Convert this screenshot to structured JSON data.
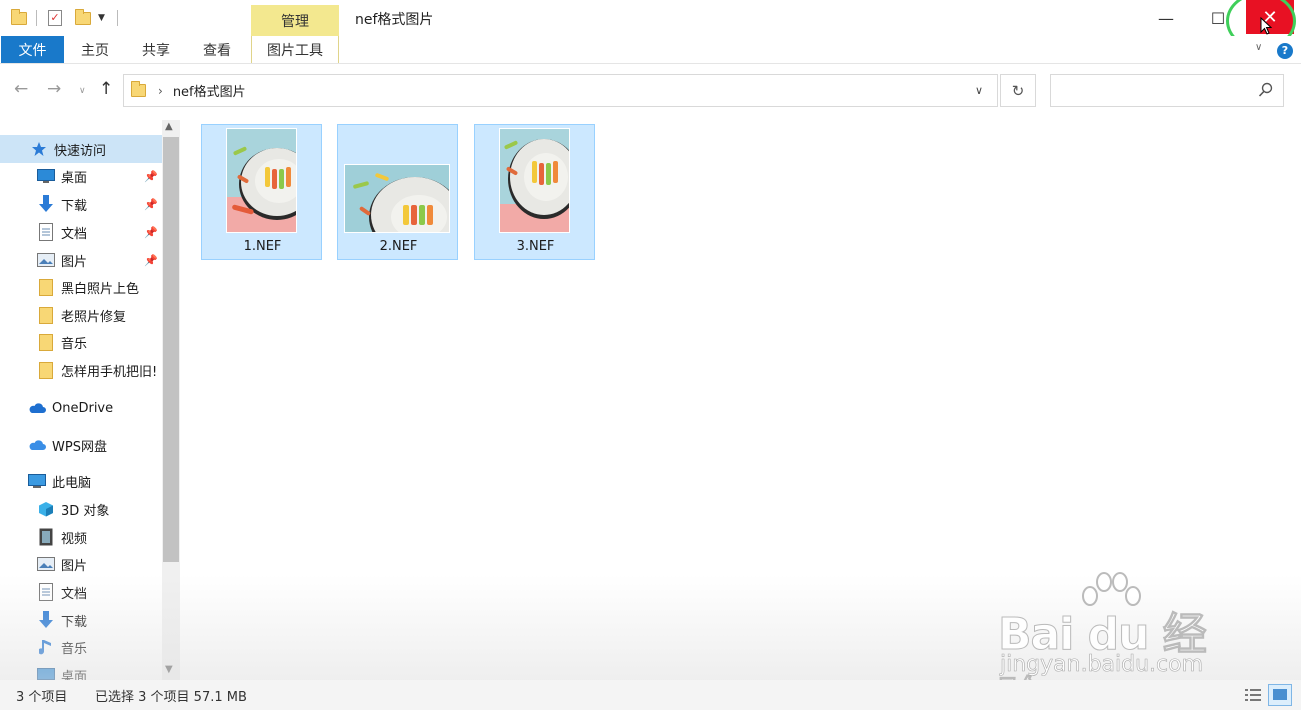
{
  "window": {
    "title": "nef格式图片",
    "contextual_tab": "管理",
    "buttons": {
      "minimize": "—",
      "maximize": "☐",
      "close": "✕"
    }
  },
  "ribbon": {
    "tabs": [
      {
        "label": "文件",
        "active": true
      },
      {
        "label": "主页"
      },
      {
        "label": "共享"
      },
      {
        "label": "查看"
      },
      {
        "label": "图片工具"
      }
    ],
    "help": "?"
  },
  "address": {
    "path": "nef格式图片",
    "search_placeholder": ""
  },
  "sidebar": {
    "quick_access": {
      "label": "快速访问"
    },
    "pinned": [
      {
        "label": "桌面",
        "icon": "desktop-icon"
      },
      {
        "label": "下载",
        "icon": "download-icon"
      },
      {
        "label": "文档",
        "icon": "document-icon"
      },
      {
        "label": "图片",
        "icon": "pictures-icon"
      }
    ],
    "folders": [
      {
        "label": "黑白照片上色"
      },
      {
        "label": "老照片修复"
      },
      {
        "label": "音乐"
      },
      {
        "label": "怎样用手机把旧!"
      }
    ],
    "onedrive": "OneDrive",
    "wps": "WPS网盘",
    "this_pc": "此电脑",
    "pc_items": [
      {
        "label": "3D 对象",
        "icon": "3d-objects-icon"
      },
      {
        "label": "视频",
        "icon": "video-icon"
      },
      {
        "label": "图片",
        "icon": "pictures-icon"
      },
      {
        "label": "文档",
        "icon": "document-icon"
      },
      {
        "label": "下载",
        "icon": "download-icon"
      },
      {
        "label": "音乐",
        "icon": "music-icon"
      },
      {
        "label": "桌面",
        "icon": "desktop-icon"
      }
    ]
  },
  "files": [
    {
      "name": "1.NEF",
      "orientation": "portrait"
    },
    {
      "name": "2.NEF",
      "orientation": "landscape"
    },
    {
      "name": "3.NEF",
      "orientation": "portrait"
    }
  ],
  "status": {
    "count": "3 个项目",
    "selection": "已选择 3 个项目  57.1 MB"
  },
  "watermark": {
    "brand": "Bai du 经验",
    "url": "jingyan.baidu.com"
  },
  "colors": {
    "accent": "#1979ca",
    "close_red": "#e81123",
    "manage_tab": "#f3e88f",
    "selection": "#cce8ff",
    "highlight_ring": "#3fcf5a"
  }
}
